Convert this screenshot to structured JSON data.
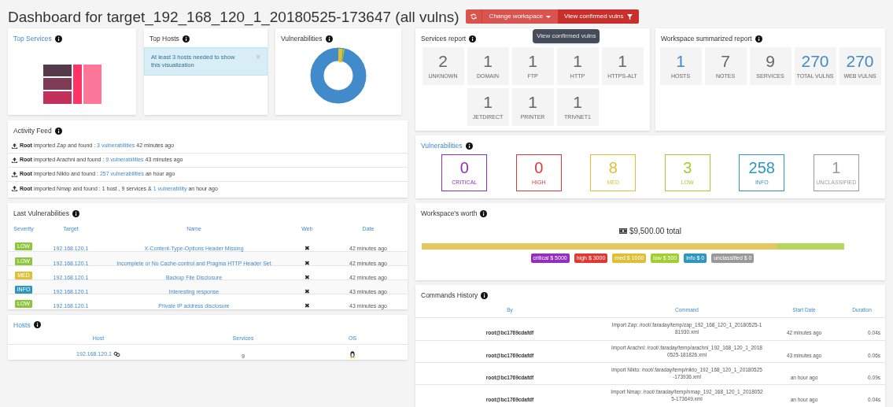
{
  "header": {
    "title": "Dashboard for target_192_168_120_1_20180525-173647 (all vulns)",
    "buttons": [
      {
        "kind": "refresh"
      },
      {
        "kind": "dropdown",
        "label": "Change workspace"
      },
      {
        "kind": "filter",
        "label": "View confirmed vulns"
      }
    ],
    "tooltip": "View confirmed vulns"
  },
  "top_services": {
    "title": "Top Services"
  },
  "top_hosts": {
    "title": "Top Hosts",
    "alert": "At least 3 hosts needed to show this visualization",
    "close": "×"
  },
  "vulnerabilities_chart": {
    "title": "Vulnerabilities"
  },
  "activity_feed": {
    "title": "Activity Feed",
    "items": [
      {
        "user": "Root",
        "action": " imported Zap and found : ",
        "link": "3 vulnerabilities",
        "time": "42 minutes ago"
      },
      {
        "user": "Root",
        "action": " imported Arachni and found : ",
        "link": "9 vulnerabilities",
        "time": "43 minutes ago"
      },
      {
        "user": "Root",
        "action": " imported Nikto and found : ",
        "link": "257 vulnerabilities",
        "time": "an hour ago"
      },
      {
        "user": "Root",
        "action": " imported Nmap and found : 1 host , 9 services & ",
        "link": "1 vulnerability",
        "time": "an hour ago"
      }
    ]
  },
  "last_vulnerabilities": {
    "title": "Last Vulnerabilities",
    "columns": [
      "Severity",
      "Target",
      "Name",
      "Web",
      "Date"
    ],
    "rows": [
      {
        "severity": "LOW",
        "color": "#8cc63f",
        "target": "192.168.120.1",
        "name": "X-Content-Type-Options Header Missing",
        "web": "✖",
        "date": "42 minutes ago"
      },
      {
        "severity": "LOW",
        "color": "#8cc63f",
        "target": "192.168.120.1",
        "name": "Incomplete or No Cache-control and Pragma HTTP Header Set",
        "web": "✖",
        "date": "42 minutes ago"
      },
      {
        "severity": "MED",
        "color": "#dfbf35",
        "target": "192.168.120.1",
        "name": "Backup File Disclosure",
        "web": "✖",
        "date": "42 minutes ago"
      },
      {
        "severity": "INFO",
        "color": "#2e97bd",
        "target": "192.168.120.1",
        "name": "Interesting response",
        "web": "✖",
        "date": "43 minutes ago"
      },
      {
        "severity": "LOW",
        "color": "#8cc63f",
        "target": "192.168.120.1",
        "name": "Private IP address disclosure",
        "web": "✖",
        "date": "43 minutes ago"
      }
    ]
  },
  "hosts": {
    "title": "Hosts",
    "columns": [
      "Host",
      "Services",
      "OS"
    ],
    "rows": [
      {
        "host": "192.168.120.1",
        "services": "9"
      }
    ]
  },
  "services_report": {
    "title": "Services report",
    "items": [
      {
        "count": "2",
        "label": "UNKNOWN"
      },
      {
        "count": "1",
        "label": "DOMAIN"
      },
      {
        "count": "1",
        "label": "FTP"
      },
      {
        "count": "1",
        "label": "HTTP"
      },
      {
        "count": "1",
        "label": "HTTPS-ALT"
      },
      {
        "count": "1",
        "label": "JETDIRECT"
      },
      {
        "count": "1",
        "label": "PRINTER"
      },
      {
        "count": "1",
        "label": "TRIVNET1"
      }
    ]
  },
  "workspace_summary": {
    "title": "Workspace summarized report",
    "items": [
      {
        "count": "1",
        "label": "HOSTS",
        "highlight": true
      },
      {
        "count": "7",
        "label": "NOTES",
        "highlight": false
      },
      {
        "count": "9",
        "label": "SERVICES",
        "highlight": false
      },
      {
        "count": "270",
        "label": "TOTAL VULNS",
        "highlight": true
      },
      {
        "count": "270",
        "label": "WEB VULNS",
        "highlight": true
      }
    ]
  },
  "vulnerabilities": {
    "title": "Vulnerabilities",
    "items": [
      {
        "count": "0",
        "label": "CRITICAL",
        "color": "#932ebe"
      },
      {
        "count": "0",
        "label": "HIGH",
        "color": "#df3936"
      },
      {
        "count": "8",
        "label": "MED",
        "color": "#dfbf35"
      },
      {
        "count": "3",
        "label": "LOW",
        "color": "#a1ce31"
      },
      {
        "count": "258",
        "label": "INFO",
        "color": "#2e97bd"
      },
      {
        "count": "1",
        "label": "UNCLASSIFIED",
        "color": "#999999"
      }
    ]
  },
  "worth": {
    "title": "Workspace's worth",
    "total": "$9,500.00 total",
    "bar": {
      "level": 0.842
    },
    "legend": [
      {
        "label": "critical $ 5000",
        "color": "#932ebe"
      },
      {
        "label": "high $ 3000",
        "color": "#df3936"
      },
      {
        "label": "med $ 1000",
        "color": "#dfbf35"
      },
      {
        "label": "low $ 500",
        "color": "#a1ce31"
      },
      {
        "label": "info $ 0",
        "color": "#2e97bd"
      },
      {
        "label": "unclassified $ 0",
        "color": "#999999"
      }
    ]
  },
  "commands_history": {
    "title": "Commands History",
    "columns": [
      "By",
      "Command",
      "Start Date",
      "Duration"
    ],
    "rows": [
      {
        "by": "root@bc1769cdafdf",
        "command": "Import Zap: /root/.faraday/temp/zap_192_168_120_1_20180525-181930.xml",
        "start": "42 minutes ago",
        "duration": "0.04s"
      },
      {
        "by": "root@bc1769cdafdf",
        "command": "Import Arachni: /root/.faraday/temp/arachni_192_168_120_1_20180525-181826.xml",
        "start": "43 minutes ago",
        "duration": "0.06s"
      },
      {
        "by": "root@bc1769cdafdf",
        "command": "Import Nikto: /root/.faraday/temp/nikto_192_168_120_1_20180525-173936.xml",
        "start": "an hour ago",
        "duration": "0.09s"
      },
      {
        "by": "root@bc1769cdafdf",
        "command": "Import Nmap: /root/.faraday/temp/nmap_192_168_120_1_20180525-173649.xml",
        "start": "an hour ago",
        "duration": "0.04s"
      }
    ]
  }
}
